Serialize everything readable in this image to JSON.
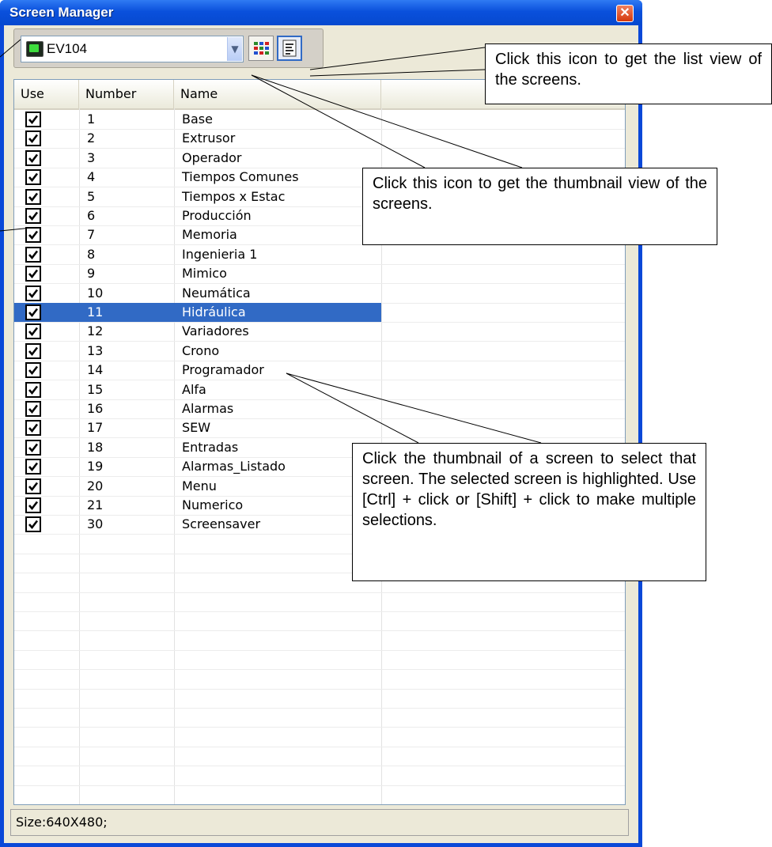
{
  "window": {
    "title": "Screen Manager",
    "close_glyph": "✕"
  },
  "toolbar": {
    "project_name": "EV104",
    "thumbnail_button": "thumbnail-view-icon",
    "list_button": "list-view-icon"
  },
  "columns": [
    "Use",
    "Number",
    "Name"
  ],
  "rows": [
    {
      "use": true,
      "number": "1",
      "name": "Base"
    },
    {
      "use": true,
      "number": "2",
      "name": "Extrusor"
    },
    {
      "use": true,
      "number": "3",
      "name": "Operador"
    },
    {
      "use": true,
      "number": "4",
      "name": "Tiempos Comunes"
    },
    {
      "use": true,
      "number": "5",
      "name": "Tiempos x Estac"
    },
    {
      "use": true,
      "number": "6",
      "name": "Producción"
    },
    {
      "use": true,
      "number": "7",
      "name": "Memoria"
    },
    {
      "use": true,
      "number": "8",
      "name": "Ingenieria 1"
    },
    {
      "use": true,
      "number": "9",
      "name": "Mimico"
    },
    {
      "use": true,
      "number": "10",
      "name": "Neumática"
    },
    {
      "use": true,
      "number": "11",
      "name": "Hidráulica",
      "selected": true
    },
    {
      "use": true,
      "number": "12",
      "name": "Variadores"
    },
    {
      "use": true,
      "number": "13",
      "name": "Crono"
    },
    {
      "use": true,
      "number": "14",
      "name": "Programador"
    },
    {
      "use": true,
      "number": "15",
      "name": "Alfa"
    },
    {
      "use": true,
      "number": "16",
      "name": "Alarmas"
    },
    {
      "use": true,
      "number": "17",
      "name": "SEW"
    },
    {
      "use": true,
      "number": "18",
      "name": "Entradas"
    },
    {
      "use": true,
      "number": "19",
      "name": "Alarmas_Listado"
    },
    {
      "use": true,
      "number": "20",
      "name": "Menu"
    },
    {
      "use": true,
      "number": "21",
      "name": "Numerico"
    },
    {
      "use": true,
      "number": "30",
      "name": "Screensaver"
    }
  ],
  "status": "Size:640X480;",
  "callouts": {
    "list_view": "Click this icon to get the list view of the screens.",
    "thumbnail_view": "Click this icon to get the thumbnail view of the screens.",
    "select": "Click the thumbnail of a screen to select that screen. The selected screen is highlighted. Use [Ctrl] + click or [Shift] + click to make multiple selections."
  },
  "colors": {
    "title_bar": "#0a50dc",
    "selection": "#316ac5",
    "client": "#ece9d8"
  }
}
